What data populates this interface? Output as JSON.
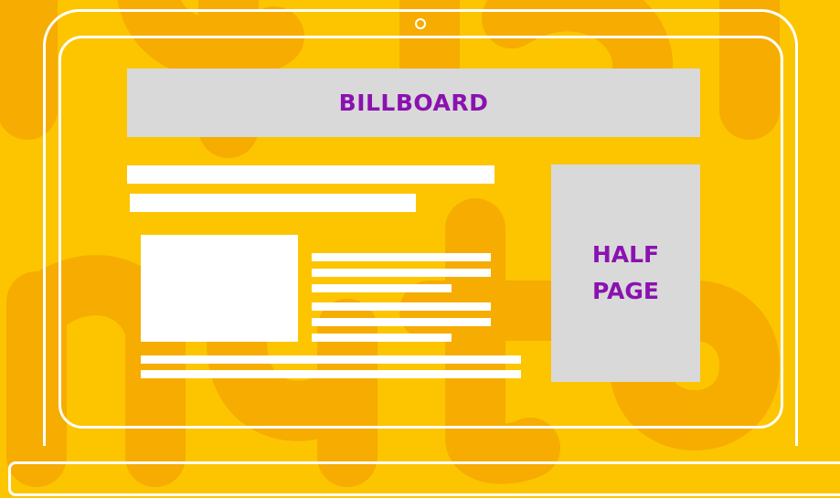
{
  "colors": {
    "background": "#fcc500",
    "background_shapes": "#f5a800",
    "outline": "#ffffff",
    "ad_slot_fill": "#d9d9d9",
    "ad_label": "#8a12b0"
  },
  "ads": {
    "billboard": "BILLBOARD",
    "half_page_line1": "HALF",
    "half_page_line2": "PAGE"
  }
}
